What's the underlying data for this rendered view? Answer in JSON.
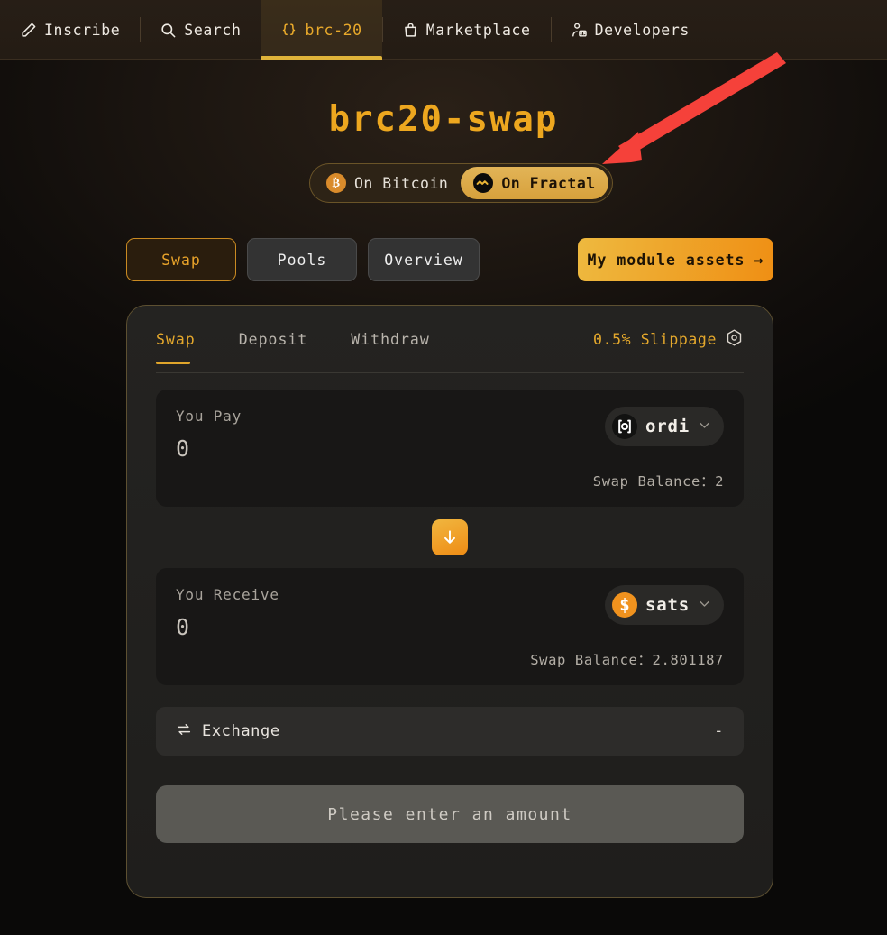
{
  "nav": {
    "items": [
      {
        "label": "Inscribe",
        "icon": "pencil-icon",
        "active": false
      },
      {
        "label": "Search",
        "icon": "search-icon",
        "active": false
      },
      {
        "label": "brc-20",
        "icon": "braces-icon",
        "active": true
      },
      {
        "label": "Marketplace",
        "icon": "shopping-bag-icon",
        "active": false
      },
      {
        "label": "Developers",
        "icon": "developer-icon",
        "active": false
      }
    ]
  },
  "header": {
    "title": "brc20-swap"
  },
  "chain_toggle": {
    "options": [
      {
        "label": "On Bitcoin",
        "icon": "bitcoin-icon",
        "selected": false
      },
      {
        "label": "On Fractal",
        "icon": "fractal-icon",
        "selected": true
      }
    ]
  },
  "actions": {
    "swap_label": "Swap",
    "pools_label": "Pools",
    "overview_label": "Overview",
    "module_assets_label": "My module assets",
    "module_assets_arrow": "→"
  },
  "card": {
    "tabs": [
      {
        "label": "Swap",
        "active": true
      },
      {
        "label": "Deposit",
        "active": false
      },
      {
        "label": "Withdraw",
        "active": false
      }
    ],
    "slippage": "0.5% Slippage",
    "pay": {
      "label": "You Pay",
      "amount": "0",
      "token": "ordi",
      "token_icon": "ordi-icon",
      "balance": "Swap Balance：2"
    },
    "receive": {
      "label": "You Receive",
      "amount": "0",
      "token": "sats",
      "token_icon": "sats-icon",
      "balance": "Swap Balance：2.801187"
    },
    "exchange": {
      "label": "Exchange",
      "value": "-"
    },
    "cta_label": "Please enter an amount"
  },
  "colors": {
    "accent_gold": "#e8a92b",
    "accent_orange": "#ef8f14",
    "annotation_red": "#f5413a",
    "page_bg": "#0a0908"
  }
}
